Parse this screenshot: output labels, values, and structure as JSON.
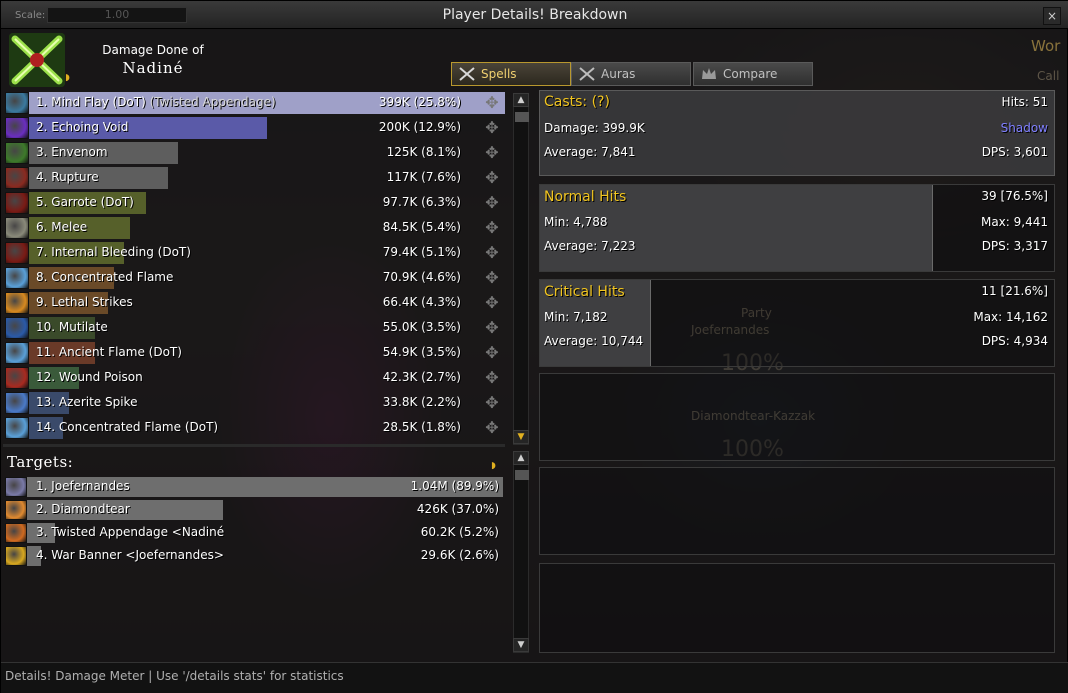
{
  "window": {
    "title": "Player Details! Breakdown",
    "scale_label": "Scale:",
    "scale_value": "1.00",
    "close_glyph": "×"
  },
  "header": {
    "caption": "Damage Done of",
    "player_name": "Nadiné"
  },
  "tabs": [
    {
      "label": "Spells",
      "icon": "crossed-swords-icon",
      "active": true
    },
    {
      "label": "Auras",
      "icon": "crossed-swords-icon",
      "active": false
    },
    {
      "label": "Compare",
      "icon": "crown-icon",
      "active": false
    }
  ],
  "spells": [
    {
      "rank": "1.",
      "name": "Mind Flay (DoT)",
      "suffix": " (Twisted Appendage)",
      "value": "399K (25.8%)",
      "pct": 100,
      "bar_color": "#9fa0c8",
      "icon_color": "#3b7aa0"
    },
    {
      "rank": "2.",
      "name": "Echoing Void",
      "suffix": "",
      "value": "200K (12.9%)",
      "pct": 50.1,
      "bar_color": "#5a5aa8",
      "icon_color": "#6a2ec0"
    },
    {
      "rank": "3.",
      "name": "Envenom",
      "suffix": "",
      "value": "125K (8.1%)",
      "pct": 31.3,
      "bar_color": "#5e5e5e",
      "icon_color": "#3d7a2a"
    },
    {
      "rank": "4.",
      "name": "Rupture",
      "suffix": "",
      "value": "117K (7.6%)",
      "pct": 29.3,
      "bar_color": "#5e5e5e",
      "icon_color": "#8a2a20"
    },
    {
      "rank": "5.",
      "name": "Garrote (DoT)",
      "suffix": "",
      "value": "97.7K (6.3%)",
      "pct": 24.5,
      "bar_color": "#56602a",
      "icon_color": "#7a1a14"
    },
    {
      "rank": "6.",
      "name": "Melee",
      "suffix": "",
      "value": "84.5K (5.4%)",
      "pct": 21.2,
      "bar_color": "#56602a",
      "icon_color": "#8a8a7a"
    },
    {
      "rank": "7.",
      "name": "Internal Bleeding (DoT)",
      "suffix": "",
      "value": "79.4K (5.1%)",
      "pct": 19.9,
      "bar_color": "#56602a",
      "icon_color": "#7a1a14"
    },
    {
      "rank": "8.",
      "name": "Concentrated Flame",
      "suffix": "",
      "value": "70.9K (4.6%)",
      "pct": 17.8,
      "bar_color": "#6a4a28",
      "icon_color": "#5aa0d8"
    },
    {
      "rank": "9.",
      "name": "Lethal Strikes",
      "suffix": "",
      "value": "66.4K (4.3%)",
      "pct": 16.6,
      "bar_color": "#6a4a28",
      "icon_color": "#d88a20"
    },
    {
      "rank": "10.",
      "name": "Mutilate",
      "suffix": "",
      "value": "55.0K (3.5%)",
      "pct": 13.8,
      "bar_color": "#3a4a2a",
      "icon_color": "#2a5aa8"
    },
    {
      "rank": "11.",
      "name": "Ancient Flame (DoT)",
      "suffix": "",
      "value": "54.9K (3.5%)",
      "pct": 13.8,
      "bar_color": "#6a3a28",
      "icon_color": "#5aa0d8"
    },
    {
      "rank": "12.",
      "name": "Wound Poison",
      "suffix": "",
      "value": "42.3K (2.7%)",
      "pct": 10.6,
      "bar_color": "#3a5a3a",
      "icon_color": "#a82a20"
    },
    {
      "rank": "13.",
      "name": "Azerite Spike",
      "suffix": "",
      "value": "33.8K (2.2%)",
      "pct": 8.5,
      "bar_color": "#3a4a6a",
      "icon_color": "#4a7ac8"
    },
    {
      "rank": "14.",
      "name": "Concentrated Flame (DoT)",
      "suffix": "",
      "value": "28.5K (1.8%)",
      "pct": 7.1,
      "bar_color": "#3a4a6a",
      "icon_color": "#5aa0d8"
    }
  ],
  "targets_label": "Targets:",
  "targets": [
    {
      "rank": "1.",
      "name": "Joefernandes",
      "value": "1.04M (89.9%)",
      "pct": 100,
      "bar_color": "#6e6e6e",
      "icon_color": "#7a7aa8"
    },
    {
      "rank": "2.",
      "name": "Diamondtear",
      "value": "426K (37.0%)",
      "pct": 41.2,
      "bar_color": "#6e6e6e",
      "icon_color": "#e08a30"
    },
    {
      "rank": "3.",
      "name": "Twisted Appendage <Nadiné",
      "value": "60.2K (5.2%)",
      "pct": 5.8,
      "bar_color": "#6e6e6e",
      "icon_color": "#d06a20"
    },
    {
      "rank": "4.",
      "name": "War Banner <Joefernandes>",
      "value": "29.6K (2.6%)",
      "pct": 2.9,
      "bar_color": "#6e6e6e",
      "icon_color": "#d8a820"
    }
  ],
  "casts_panel": {
    "title": "Casts: (?)",
    "hits": "Hits: 51",
    "damage": "Damage: 399.9K",
    "school": "Shadow",
    "average": "Average: 7,841",
    "dps": "DPS: 3,601"
  },
  "normal_panel": {
    "title": "Normal Hits",
    "count": "39 [76.5%]",
    "min": "Min: 4,788",
    "max": "Max: 9,441",
    "average": "Average: 7,223",
    "dps": "DPS: 3,317",
    "pct": 76.5
  },
  "crit_panel": {
    "title": "Critical Hits",
    "count": "11 [21.6%]",
    "min": "Min: 7,182",
    "max": "Max: 14,162",
    "average": "Average: 10,744",
    "dps": "DPS: 4,934",
    "pct": 21.6
  },
  "footer": {
    "text": "Details! Damage Meter | Use '/details stats' for statistics"
  },
  "background": {
    "world_text": "Wor",
    "call_text": "Call",
    "party_label": "Party",
    "party_member_1": "Joefernandes",
    "party_pct_1": "100%",
    "party_member_2": "Diamondtear-Kazzak",
    "party_pct_2": "100%"
  },
  "colors": {
    "title_gold": "#f0c420",
    "shadow_school": "#8080ff"
  }
}
